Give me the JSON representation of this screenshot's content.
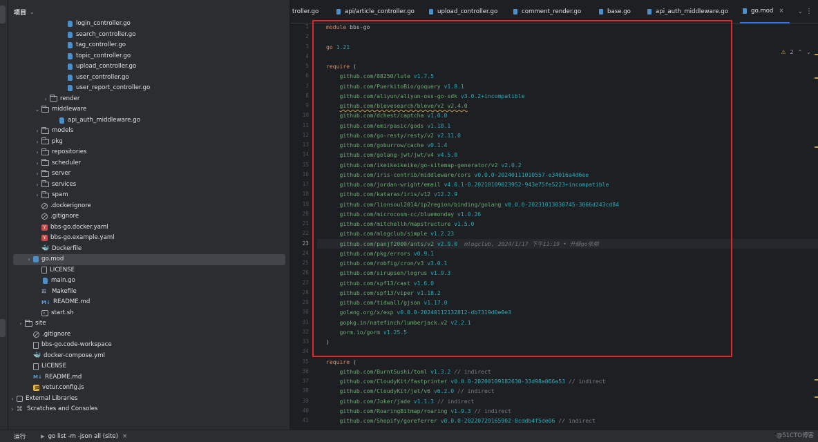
{
  "project_panel": {
    "title": "项目",
    "tree": [
      {
        "label": "login_controller.go",
        "icon": "go-file-icon",
        "depth": 7
      },
      {
        "label": "search_controller.go",
        "icon": "go-file-icon",
        "depth": 7
      },
      {
        "label": "tag_controller.go",
        "icon": "go-file-icon",
        "depth": 7
      },
      {
        "label": "topic_controller.go",
        "icon": "go-file-icon",
        "depth": 7
      },
      {
        "label": "upload_controller.go",
        "icon": "go-file-icon",
        "depth": 7
      },
      {
        "label": "user_controller.go",
        "icon": "go-file-icon",
        "depth": 7
      },
      {
        "label": "user_report_controller.go",
        "icon": "go-file-icon",
        "depth": 7
      },
      {
        "label": "render",
        "icon": "folder-icon",
        "depth": 5,
        "arrow": "›"
      },
      {
        "label": "middleware",
        "icon": "folder-icon",
        "depth": 4,
        "arrow": "⌄"
      },
      {
        "label": "api_auth_middleware.go",
        "icon": "go-file-icon",
        "depth": 6
      },
      {
        "label": "models",
        "icon": "folder-icon",
        "depth": 4,
        "arrow": "›"
      },
      {
        "label": "pkg",
        "icon": "folder-icon",
        "depth": 4,
        "arrow": "›"
      },
      {
        "label": "repositories",
        "icon": "folder-icon",
        "depth": 4,
        "arrow": "›"
      },
      {
        "label": "scheduler",
        "icon": "folder-icon",
        "depth": 4,
        "arrow": "›"
      },
      {
        "label": "server",
        "icon": "folder-icon",
        "depth": 4,
        "arrow": "›"
      },
      {
        "label": "services",
        "icon": "folder-icon",
        "depth": 4,
        "arrow": "›"
      },
      {
        "label": "spam",
        "icon": "folder-icon",
        "depth": 4,
        "arrow": "›"
      },
      {
        "label": ".dockerignore",
        "icon": "ignore-file-icon",
        "depth": 4
      },
      {
        "label": ".gitignore",
        "icon": "ignore-file-icon",
        "depth": 4
      },
      {
        "label": "bbs-go.docker.yaml",
        "icon": "yaml-file-icon",
        "depth": 4
      },
      {
        "label": "bbs-go.example.yaml",
        "icon": "yaml-file-icon",
        "depth": 4
      },
      {
        "label": "Dockerfile",
        "icon": "docker-icon",
        "depth": 4
      },
      {
        "label": "go.mod",
        "icon": "go-mod-icon",
        "depth": 3,
        "arrow": "›",
        "selected": true
      },
      {
        "label": "LICENSE",
        "icon": "text-file-icon",
        "depth": 4
      },
      {
        "label": "main.go",
        "icon": "go-file-icon",
        "depth": 4
      },
      {
        "label": "Makefile",
        "icon": "makefile-icon",
        "depth": 4
      },
      {
        "label": "README.md",
        "icon": "markdown-icon",
        "depth": 4
      },
      {
        "label": "start.sh",
        "icon": "shell-file-icon",
        "depth": 4
      },
      {
        "label": "site",
        "icon": "folder-icon",
        "depth": 2,
        "arrow": "›"
      },
      {
        "label": ".gitignore",
        "icon": "ignore-file-icon",
        "depth": 3
      },
      {
        "label": "bbs-go.code-workspace",
        "icon": "text-file-icon",
        "depth": 3
      },
      {
        "label": "docker-compose.yml",
        "icon": "docker-icon",
        "depth": 3
      },
      {
        "label": "LICENSE",
        "icon": "text-file-icon",
        "depth": 3
      },
      {
        "label": "README.md",
        "icon": "markdown-icon",
        "depth": 3
      },
      {
        "label": "vetur.config.js",
        "icon": "js-file-icon",
        "depth": 3
      },
      {
        "label": "External Libraries",
        "icon": "library-icon",
        "depth": 1,
        "arrow": "›"
      },
      {
        "label": "Scratches and Consoles",
        "icon": "scratch-icon",
        "depth": 1,
        "arrow": "›"
      }
    ]
  },
  "tabs": [
    {
      "label": "troller.go",
      "active": false
    },
    {
      "label": "api/article_controller.go",
      "active": false
    },
    {
      "label": "upload_controller.go",
      "active": false
    },
    {
      "label": "comment_render.go",
      "active": false
    },
    {
      "label": "base.go",
      "active": false
    },
    {
      "label": "api_auth_middleware.go",
      "active": false
    },
    {
      "label": "go.mod",
      "active": true,
      "close": "×"
    }
  ],
  "inspection": {
    "warning_count": "2",
    "up": "⌃",
    "down": "⌄"
  },
  "editor": {
    "current_line": 23,
    "lines": [
      {
        "n": "1",
        "parts": [
          {
            "t": "module ",
            "c": "kw"
          },
          {
            "t": "bbs-go",
            "c": ""
          }
        ]
      },
      {
        "n": "2",
        "parts": []
      },
      {
        "n": "3",
        "parts": [
          {
            "t": "go ",
            "c": "kw"
          },
          {
            "t": "1.21",
            "c": "ver"
          }
        ]
      },
      {
        "n": "4",
        "parts": []
      },
      {
        "n": "5",
        "parts": [
          {
            "t": "require ",
            "c": "kw"
          },
          {
            "t": "(",
            "c": ""
          }
        ]
      },
      {
        "n": "6",
        "parts": [
          {
            "t": "    github.com/88250/lute ",
            "c": "pkg"
          },
          {
            "t": "v1.7.5",
            "c": "ver"
          }
        ]
      },
      {
        "n": "7",
        "parts": [
          {
            "t": "    github.com/PuerkitoBio/goquery ",
            "c": "pkg"
          },
          {
            "t": "v1.8.1",
            "c": "ver"
          }
        ]
      },
      {
        "n": "8",
        "parts": [
          {
            "t": "    github.com/aliyun/aliyun-oss-go-sdk ",
            "c": "pkg"
          },
          {
            "t": "v3.0.2+incompatible",
            "c": "ver"
          }
        ]
      },
      {
        "n": "9",
        "parts": [
          {
            "t": "    ",
            "c": "pkg"
          },
          {
            "t": "github.com/blevesearch/bleve/v2 v2.4.0",
            "c": "pkg warn"
          }
        ]
      },
      {
        "n": "10",
        "parts": [
          {
            "t": "    github.com/dchest/captcha ",
            "c": "pkg"
          },
          {
            "t": "v1.0.0",
            "c": "ver"
          }
        ]
      },
      {
        "n": "11",
        "parts": [
          {
            "t": "    github.com/emirpasic/gods ",
            "c": "pkg"
          },
          {
            "t": "v1.18.1",
            "c": "ver"
          }
        ]
      },
      {
        "n": "12",
        "parts": [
          {
            "t": "    github.com/go-resty/resty/v2 ",
            "c": "pkg"
          },
          {
            "t": "v2.11.0",
            "c": "ver"
          }
        ]
      },
      {
        "n": "13",
        "parts": [
          {
            "t": "    github.com/goburrow/cache ",
            "c": "pkg"
          },
          {
            "t": "v0.1.4",
            "c": "ver"
          }
        ]
      },
      {
        "n": "14",
        "parts": [
          {
            "t": "    github.com/golang-jwt/jwt/v4 ",
            "c": "pkg"
          },
          {
            "t": "v4.5.0",
            "c": "ver"
          }
        ]
      },
      {
        "n": "15",
        "parts": [
          {
            "t": "    github.com/ikeikeikeike/go-sitemap-generator/v2 ",
            "c": "pkg"
          },
          {
            "t": "v2.0.2",
            "c": "ver"
          }
        ]
      },
      {
        "n": "16",
        "parts": [
          {
            "t": "    github.com/iris-contrib/middleware/cors ",
            "c": "pkg"
          },
          {
            "t": "v0.0.0-20240111010557-e34016a4d6ee",
            "c": "ver"
          }
        ]
      },
      {
        "n": "17",
        "parts": [
          {
            "t": "    github.com/jordan-wright/email ",
            "c": "pkg"
          },
          {
            "t": "v4.0.1-0.20210109023952-943e75fe5223+incompatible",
            "c": "ver"
          }
        ]
      },
      {
        "n": "18",
        "parts": [
          {
            "t": "    github.com/kataras/iris/v12 ",
            "c": "pkg"
          },
          {
            "t": "v12.2.9",
            "c": "ver"
          }
        ]
      },
      {
        "n": "19",
        "parts": [
          {
            "t": "    github.com/lionsoul2014/ip2region/binding/golang ",
            "c": "pkg"
          },
          {
            "t": "v0.0.0-20231013030745-3066d243cd84",
            "c": "ver"
          }
        ]
      },
      {
        "n": "20",
        "parts": [
          {
            "t": "    github.com/microcosm-cc/bluemonday ",
            "c": "pkg"
          },
          {
            "t": "v1.0.26",
            "c": "ver"
          }
        ]
      },
      {
        "n": "21",
        "parts": [
          {
            "t": "    github.com/mitchellh/mapstructure ",
            "c": "pkg"
          },
          {
            "t": "v1.5.0",
            "c": "ver"
          }
        ]
      },
      {
        "n": "22",
        "parts": [
          {
            "t": "    github.com/mlogclub/simple ",
            "c": "pkg"
          },
          {
            "t": "v1.2.23",
            "c": "ver"
          }
        ]
      },
      {
        "n": "23",
        "parts": [
          {
            "t": "    github.com/panjf2000/ants/v2 ",
            "c": "pkg"
          },
          {
            "t": "v2.9.0",
            "c": "ver"
          },
          {
            "t": "mlogclub, 2024/1/17 下午11:19 • 升级go依赖",
            "c": "blame"
          }
        ]
      },
      {
        "n": "24",
        "parts": [
          {
            "t": "    github.com/pkg/errors ",
            "c": "pkg"
          },
          {
            "t": "v0.9.1",
            "c": "ver"
          }
        ]
      },
      {
        "n": "25",
        "parts": [
          {
            "t": "    github.com/robfig/cron/v3 ",
            "c": "pkg"
          },
          {
            "t": "v3.0.1",
            "c": "ver"
          }
        ]
      },
      {
        "n": "26",
        "parts": [
          {
            "t": "    github.com/sirupsen/logrus ",
            "c": "pkg"
          },
          {
            "t": "v1.9.3",
            "c": "ver"
          }
        ]
      },
      {
        "n": "27",
        "parts": [
          {
            "t": "    github.com/spf13/cast ",
            "c": "pkg"
          },
          {
            "t": "v1.6.0",
            "c": "ver"
          }
        ]
      },
      {
        "n": "28",
        "parts": [
          {
            "t": "    github.com/spf13/viper ",
            "c": "pkg"
          },
          {
            "t": "v1.18.2",
            "c": "ver"
          }
        ]
      },
      {
        "n": "29",
        "parts": [
          {
            "t": "    github.com/tidwall/gjson ",
            "c": "pkg"
          },
          {
            "t": "v1.17.0",
            "c": "ver"
          }
        ]
      },
      {
        "n": "30",
        "parts": [
          {
            "t": "    golang.org/x/exp ",
            "c": "pkg"
          },
          {
            "t": "v0.0.0-20240112132812-db7319d0e0e3",
            "c": "ver"
          }
        ]
      },
      {
        "n": "31",
        "parts": [
          {
            "t": "    gopkg.in/natefinch/lumberjack.v2 ",
            "c": "pkg"
          },
          {
            "t": "v2.2.1",
            "c": "ver"
          }
        ]
      },
      {
        "n": "32",
        "parts": [
          {
            "t": "    gorm.io/gorm ",
            "c": "pkg"
          },
          {
            "t": "v1.25.5",
            "c": "ver"
          }
        ]
      },
      {
        "n": "33",
        "parts": [
          {
            "t": ")",
            "c": ""
          }
        ]
      },
      {
        "n": "34",
        "parts": []
      },
      {
        "n": "35",
        "parts": [
          {
            "t": "require ",
            "c": "kw"
          },
          {
            "t": "(",
            "c": ""
          }
        ]
      },
      {
        "n": "36",
        "parts": [
          {
            "t": "    github.com/BurntSushi/toml ",
            "c": "pkg"
          },
          {
            "t": "v1.3.2",
            "c": "ver"
          },
          {
            "t": " // indirect",
            "c": "cmt"
          }
        ]
      },
      {
        "n": "37",
        "parts": [
          {
            "t": "    github.com/CloudyKit/fastprinter ",
            "c": "pkg"
          },
          {
            "t": "v0.0.0-20200109182630-33d98a066a53",
            "c": "ver"
          },
          {
            "t": " // indirect",
            "c": "cmt"
          }
        ]
      },
      {
        "n": "38",
        "parts": [
          {
            "t": "    github.com/CloudyKit/jet/v6 ",
            "c": "pkg"
          },
          {
            "t": "v6.2.0",
            "c": "ver"
          },
          {
            "t": " // indirect",
            "c": "cmt"
          }
        ]
      },
      {
        "n": "39",
        "parts": [
          {
            "t": "    github.com/Joker/jade ",
            "c": "pkg"
          },
          {
            "t": "v1.1.3",
            "c": "ver"
          },
          {
            "t": " // indirect",
            "c": "cmt"
          }
        ]
      },
      {
        "n": "40",
        "parts": [
          {
            "t": "    github.com/RoaringBitmap/roaring ",
            "c": "pkg"
          },
          {
            "t": "v1.9.3",
            "c": "ver"
          },
          {
            "t": " // indirect",
            "c": "cmt"
          }
        ]
      },
      {
        "n": "41",
        "parts": [
          {
            "t": "    github.com/Shopify/goreferrer ",
            "c": "pkg"
          },
          {
            "t": "v0.0.0-20220729165902-8cddb4f5de06",
            "c": "ver"
          },
          {
            "t": " // indirect",
            "c": "cmt"
          }
        ]
      }
    ]
  },
  "runbar": {
    "label": "运行",
    "tab": "go list -m -json all (site)",
    "close": "×"
  },
  "watermark": "@51CTO博客",
  "colors": {
    "highlight_box": "#e0272b",
    "accent": "#3574f0",
    "package": "#6aab73",
    "version": "#2aacb8",
    "keyword": "#cf8e6d"
  }
}
